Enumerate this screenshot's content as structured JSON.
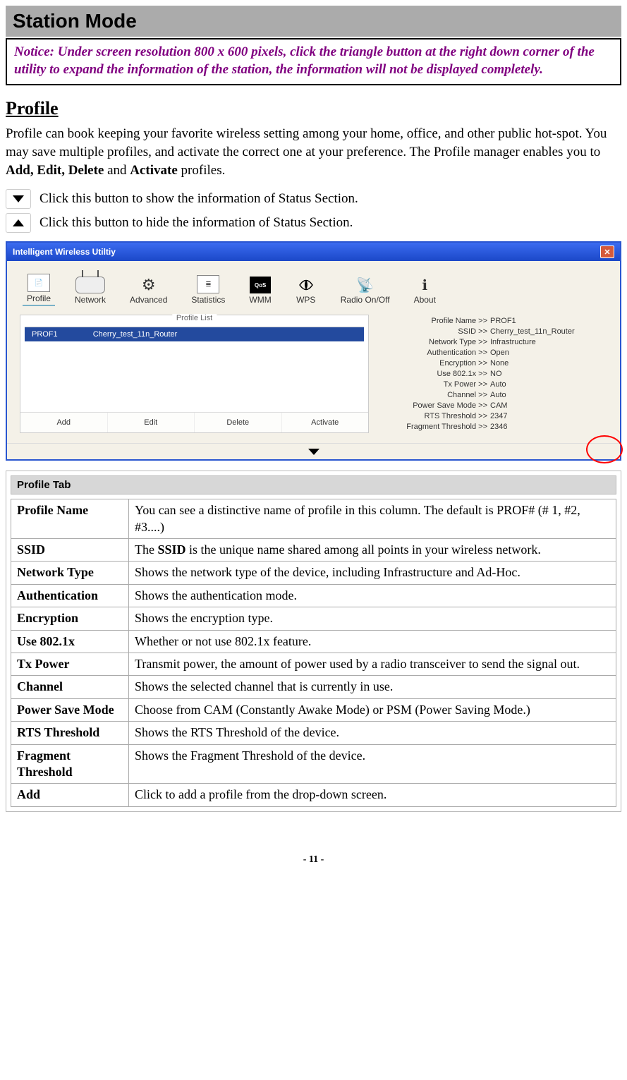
{
  "page": {
    "title": "Station Mode",
    "notice": "Notice: Under screen resolution 800 x 600 pixels, click the triangle button at the right down corner of the utility to expand the information of the station, the information will not be displayed completely.",
    "profile_heading": "Profile",
    "profile_para_pre": "Profile can book keeping your favorite wireless setting among your home, office, and other public hot-spot. You may save multiple profiles, and activate the correct one at your preference. The Profile manager enables you to ",
    "profile_para_bold1": "Add, Edit, Delete",
    "profile_para_mid": " and ",
    "profile_para_bold2": "Activate",
    "profile_para_post": " profiles.",
    "show_info_text": "Click this button to show the information of Status Section.",
    "hide_info_text": "Click this button to hide the information of Status Section.",
    "page_number": "- 11 -"
  },
  "app": {
    "title": "Intelligent Wireless Utiltiy",
    "tabs": [
      "Profile",
      "Network",
      "Advanced",
      "Statistics",
      "WMM",
      "WPS",
      "Radio On/Off",
      "About"
    ],
    "profile_list_label": "Profile List",
    "selected_profile": {
      "name": "PROF1",
      "ssid": "Cherry_test_11n_Router"
    },
    "buttons": [
      "Add",
      "Edit",
      "Delete",
      "Activate"
    ],
    "details": [
      {
        "label": "Profile Name >>",
        "value": "PROF1"
      },
      {
        "label": "SSID >>",
        "value": "Cherry_test_11n_Router"
      },
      {
        "label": "Network Type >>",
        "value": "Infrastructure"
      },
      {
        "label": "Authentication >>",
        "value": "Open"
      },
      {
        "label": "Encryption >>",
        "value": "None"
      },
      {
        "label": "Use 802.1x >>",
        "value": "NO"
      },
      {
        "label": "Tx Power >>",
        "value": "Auto"
      },
      {
        "label": "Channel >>",
        "value": "Auto"
      },
      {
        "label": "Power Save Mode >>",
        "value": "CAM"
      },
      {
        "label": "RTS Threshold >>",
        "value": "2347"
      },
      {
        "label": "Fragment Threshold >>",
        "value": "2346"
      }
    ]
  },
  "tabbox": {
    "title": "Profile Tab",
    "rows": [
      {
        "term": "Profile Name",
        "desc": "You can see a distinctive name of profile in this column. The default is PROF# (# 1, #2, #3....)"
      },
      {
        "term": "SSID",
        "desc_pre": "The ",
        "desc_bold": "SSID",
        "desc_post": " is the unique name shared among all points in your wireless network.",
        "justify": true
      },
      {
        "term": "Network Type",
        "desc": "Shows the network type of the device, including Infrastructure and Ad-Hoc."
      },
      {
        "term": "Authentication",
        "desc": "Shows the authentication mode."
      },
      {
        "term": "Encryption",
        "desc": "Shows the encryption type."
      },
      {
        "term": "Use 802.1x",
        "desc": "Whether or not use 802.1x feature."
      },
      {
        "term": "Tx Power",
        "desc": "Transmit power, the amount of power used by a radio transceiver to send the signal out."
      },
      {
        "term": "Channel",
        "desc": "Shows the selected channel that is currently in use."
      },
      {
        "term": "Power Save Mode",
        "desc": "Choose from CAM (Constantly Awake Mode) or PSM (Power Saving Mode.)"
      },
      {
        "term": "RTS Threshold",
        "desc": "Shows the RTS Threshold of the device."
      },
      {
        "term": "Fragment Threshold",
        "desc": "Shows the Fragment Threshold of the device."
      },
      {
        "term": "Add",
        "desc": "Click to add a profile from the drop-down screen."
      }
    ]
  }
}
